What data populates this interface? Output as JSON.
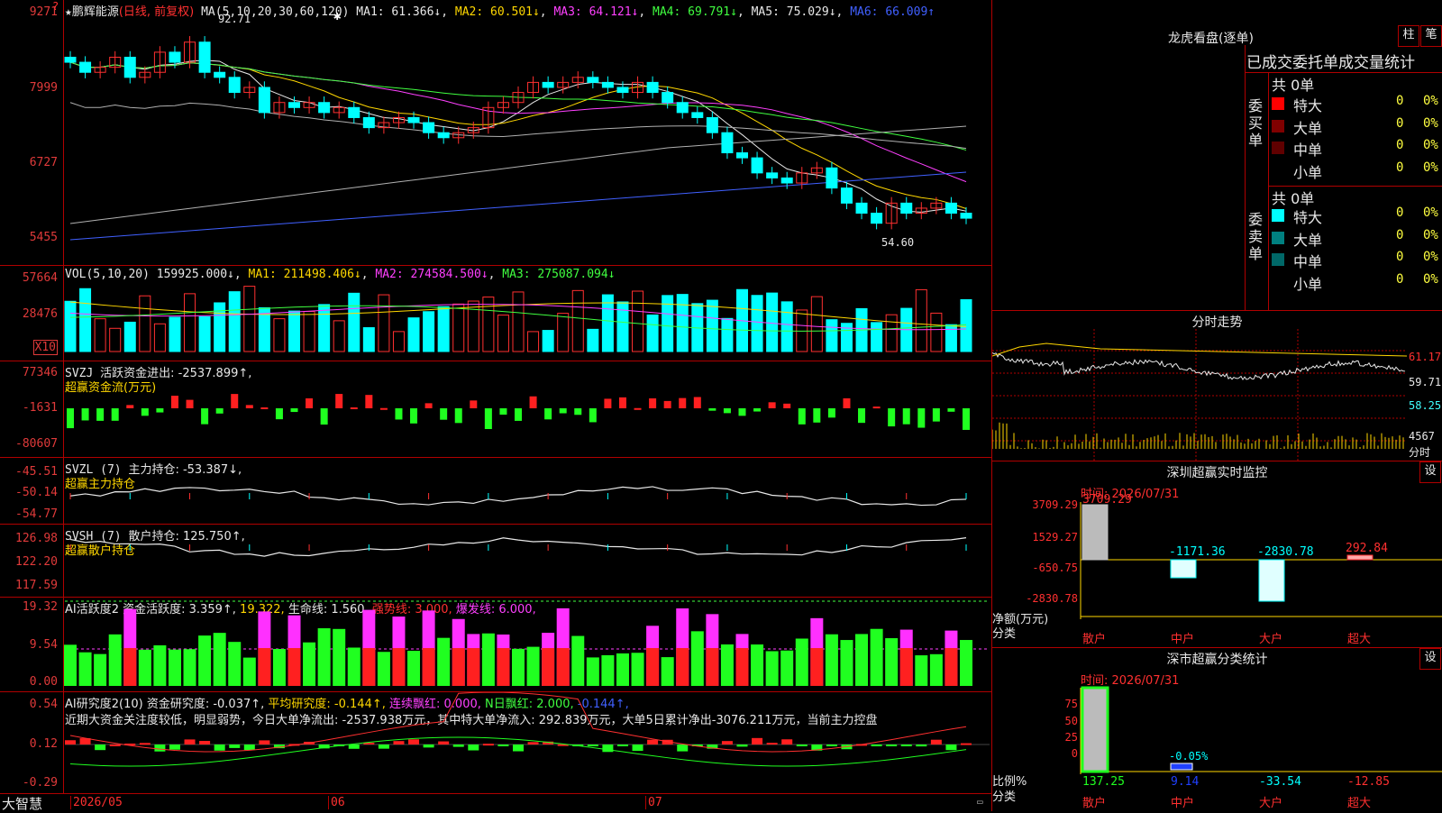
{
  "stock": {
    "name": "鹏辉能源",
    "period": "(日线, 前复权)",
    "ma_label": "MA(5,10,20,30,60,120)",
    "ma": [
      "MA1: 61.366↓",
      "MA2: 60.501↓",
      "MA3: 64.121↓",
      "MA4: 69.791↓",
      "MA5: 75.029↓",
      "MA6: 66.009↑"
    ],
    "high_label": "92.71",
    "low_label": "54.60",
    "price_axis": [
      "9271",
      "7999",
      "6727",
      "5455"
    ]
  },
  "volume": {
    "label": "VOL(5,10,20)",
    "values": [
      "159925.000↓",
      "MA1: 211498.406↓",
      "MA2: 274584.500↓",
      "MA3: 275087.094↓"
    ],
    "axis": [
      "57664",
      "28476"
    ],
    "unit": "X10"
  },
  "svzj": {
    "label": "SVZJ",
    "title": "活跃资金进出: -2537.899↑,",
    "sub": "超赢资金流(万元)",
    "axis": [
      "77346",
      "-1631",
      "-80607"
    ]
  },
  "svzl": {
    "label": "SVZL (7)",
    "title": "主力持仓: -53.387↓,",
    "sub": "超赢主力持仓",
    "axis": [
      "-45.51",
      "-50.14",
      "-54.77"
    ]
  },
  "svsh": {
    "label": "SVSH (7)",
    "title": "散户持仓: 125.750↑,",
    "sub": "超赢散户持仓",
    "axis": [
      "126.98",
      "122.20",
      "117.59"
    ]
  },
  "ai_active": {
    "label": "AI活跃度2",
    "parts": [
      "资金活跃度: 3.359↑,",
      "19.322,",
      "生命线: 1.560,",
      "强势线: 3.000,",
      "爆发线: 6.000,"
    ],
    "axis": [
      "19.32",
      "9.54",
      "0.00"
    ]
  },
  "ai_research": {
    "label": "AI研究度2(10)",
    "parts": [
      "资金研究度: -0.037↑,",
      "平均研究度: -0.144↑,",
      "连续飘红: 0.000,",
      "N日飘红: 2.000,",
      "-0.144↑,"
    ],
    "summary": "近期大资金关注度较低，明显弱势，今日大单净流出: -2537.938万元，其中特大单净流入: 292.839万元，大单5日累计净出-3076.211万元，当前主力控盘",
    "axis": [
      "0.54",
      "0.12",
      "-0.29"
    ]
  },
  "bottom": {
    "app": "大智慧",
    "dates": [
      "2026/05",
      "06",
      "07"
    ]
  },
  "dragon": {
    "title": "龙虎看盘(逐单)",
    "btn1": "柱",
    "btn2": "笔",
    "header": "已成交委托单成交量统计",
    "buy_label": "委买单",
    "sell_label": "委卖单",
    "buy_total": "共 0单",
    "sell_total": "共 0单",
    "buy_rows": [
      {
        "name": "特大",
        "v": "0",
        "p": "0%",
        "color": "#ff0000"
      },
      {
        "name": "大单",
        "v": "0",
        "p": "0%",
        "color": "#800000"
      },
      {
        "name": "中单",
        "v": "0",
        "p": "0%",
        "color": "#600000"
      },
      {
        "name": "小单",
        "v": "0",
        "p": "0%",
        "color": ""
      }
    ],
    "sell_rows": [
      {
        "name": "特大",
        "v": "0",
        "p": "0%",
        "color": "#00ffff"
      },
      {
        "name": "大单",
        "v": "0",
        "p": "0%",
        "color": "#008080"
      },
      {
        "name": "中单",
        "v": "0",
        "p": "0%",
        "color": "#006868"
      },
      {
        "name": "小单",
        "v": "0",
        "p": "0%",
        "color": ""
      }
    ]
  },
  "intraday": {
    "title": "分时走势",
    "axis": [
      "61.17",
      "59.71",
      "58.25"
    ],
    "vol": "4567",
    "vol_unit": "分时"
  },
  "monitor": {
    "title": "深圳超赢实时监控",
    "btn": "设",
    "time": "时间: 2026/07/31",
    "axis": [
      "3709.29",
      "1529.27",
      "-650.75",
      "-2830.78"
    ],
    "unit": "净额(万元)",
    "cat_label": "分类",
    "categories": [
      "散户",
      "中户",
      "大户",
      "超大"
    ],
    "values": [
      "3709.29",
      "-1171.36",
      "-2830.78",
      "292.84"
    ]
  },
  "classify": {
    "title": "深市超赢分类统计",
    "btn": "设",
    "time": "时间: 2026/07/31",
    "axis": [
      "75",
      "50",
      "25",
      "0"
    ],
    "ratio_label": "比例%",
    "cat_label": "分类",
    "categories": [
      "散户",
      "中户",
      "大户",
      "超大"
    ],
    "values": [
      "137.25",
      "9.14",
      "-33.54",
      "-12.85"
    ],
    "pct_label": "-0.05%"
  },
  "colors": {
    "up": "#ff3030",
    "down": "#00ffff",
    "grid": "#b00000",
    "ma1": "#e8e8e8",
    "ma2": "#ffd700",
    "ma3": "#ff40ff",
    "ma4": "#40ff40",
    "ma5": "#b0b0b0",
    "ma6": "#4060ff"
  }
}
